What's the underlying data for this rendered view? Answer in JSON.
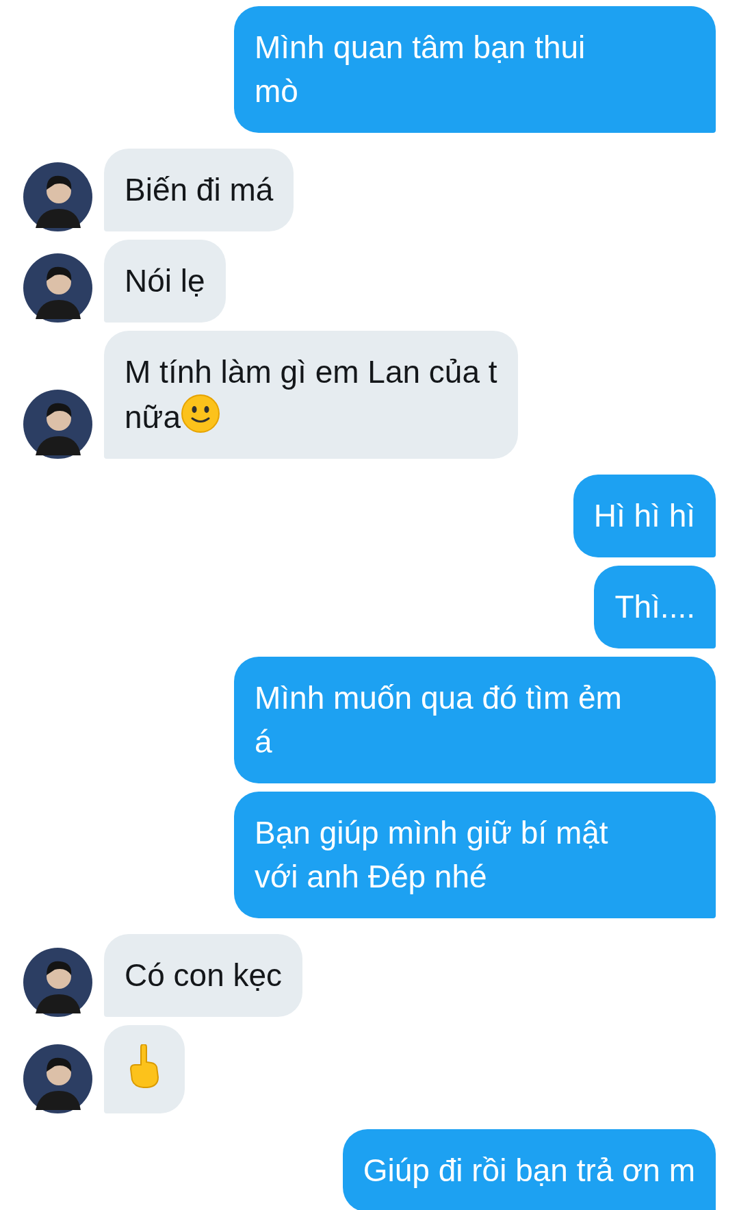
{
  "messages": [
    {
      "outgoing": true,
      "kind": "text",
      "text": "Mình quan tâm bạn thui\nmò"
    },
    {
      "outgoing": false,
      "kind": "text",
      "text": "Biến đi má"
    },
    {
      "outgoing": false,
      "kind": "text",
      "text": "Nói lẹ"
    },
    {
      "outgoing": false,
      "kind": "text_smile",
      "text": "M tính làm gì em Lan của t\nnữa"
    },
    {
      "outgoing": true,
      "kind": "text",
      "text": "Hì hì hì"
    },
    {
      "outgoing": true,
      "kind": "text",
      "text": "Thì...."
    },
    {
      "outgoing": true,
      "kind": "text",
      "text": "Mình muốn qua đó tìm ẻm\ná"
    },
    {
      "outgoing": true,
      "kind": "text",
      "text": "Bạn giúp mình giữ bí mật\nvới anh Đép nhé"
    },
    {
      "outgoing": false,
      "kind": "text",
      "text": "Có con kẹc"
    },
    {
      "outgoing": false,
      "kind": "hand"
    },
    {
      "outgoing": true,
      "kind": "text",
      "text": "Giúp đi rồi bạn trả ơn m"
    }
  ]
}
